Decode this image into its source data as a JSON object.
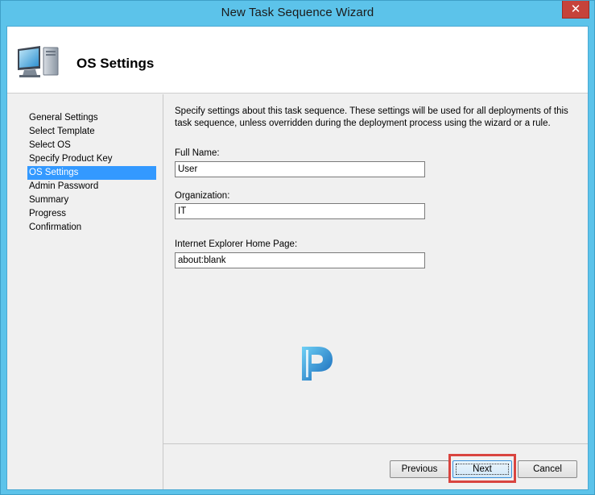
{
  "window": {
    "title": "New Task Sequence Wizard",
    "close_glyph": "✕"
  },
  "header": {
    "title": "OS Settings",
    "icon": "computer-icon"
  },
  "nav": {
    "items": [
      {
        "label": "General Settings",
        "selected": false
      },
      {
        "label": "Select Template",
        "selected": false
      },
      {
        "label": "Select OS",
        "selected": false
      },
      {
        "label": "Specify Product Key",
        "selected": false
      },
      {
        "label": "OS Settings",
        "selected": true
      },
      {
        "label": "Admin Password",
        "selected": false
      },
      {
        "label": "Summary",
        "selected": false
      },
      {
        "label": "Progress",
        "selected": false
      },
      {
        "label": "Confirmation",
        "selected": false
      }
    ]
  },
  "main": {
    "intro": "Specify settings about this task sequence.  These settings will be used for all deployments of this task sequence, unless overridden during the deployment process using the wizard or a rule.",
    "fields": {
      "full_name": {
        "label": "Full Name:",
        "value": "User"
      },
      "organization": {
        "label": "Organization:",
        "value": "IT"
      },
      "home_page": {
        "label": "Internet Explorer Home Page:",
        "value": "about:blank"
      }
    }
  },
  "footer": {
    "previous_label": "Previous",
    "next_label": "Next",
    "cancel_label": "Cancel"
  },
  "colors": {
    "title_bar": "#5cc3ea",
    "close_button": "#c6433a",
    "selection": "#3399ff",
    "highlight_frame": "#d9443f"
  }
}
